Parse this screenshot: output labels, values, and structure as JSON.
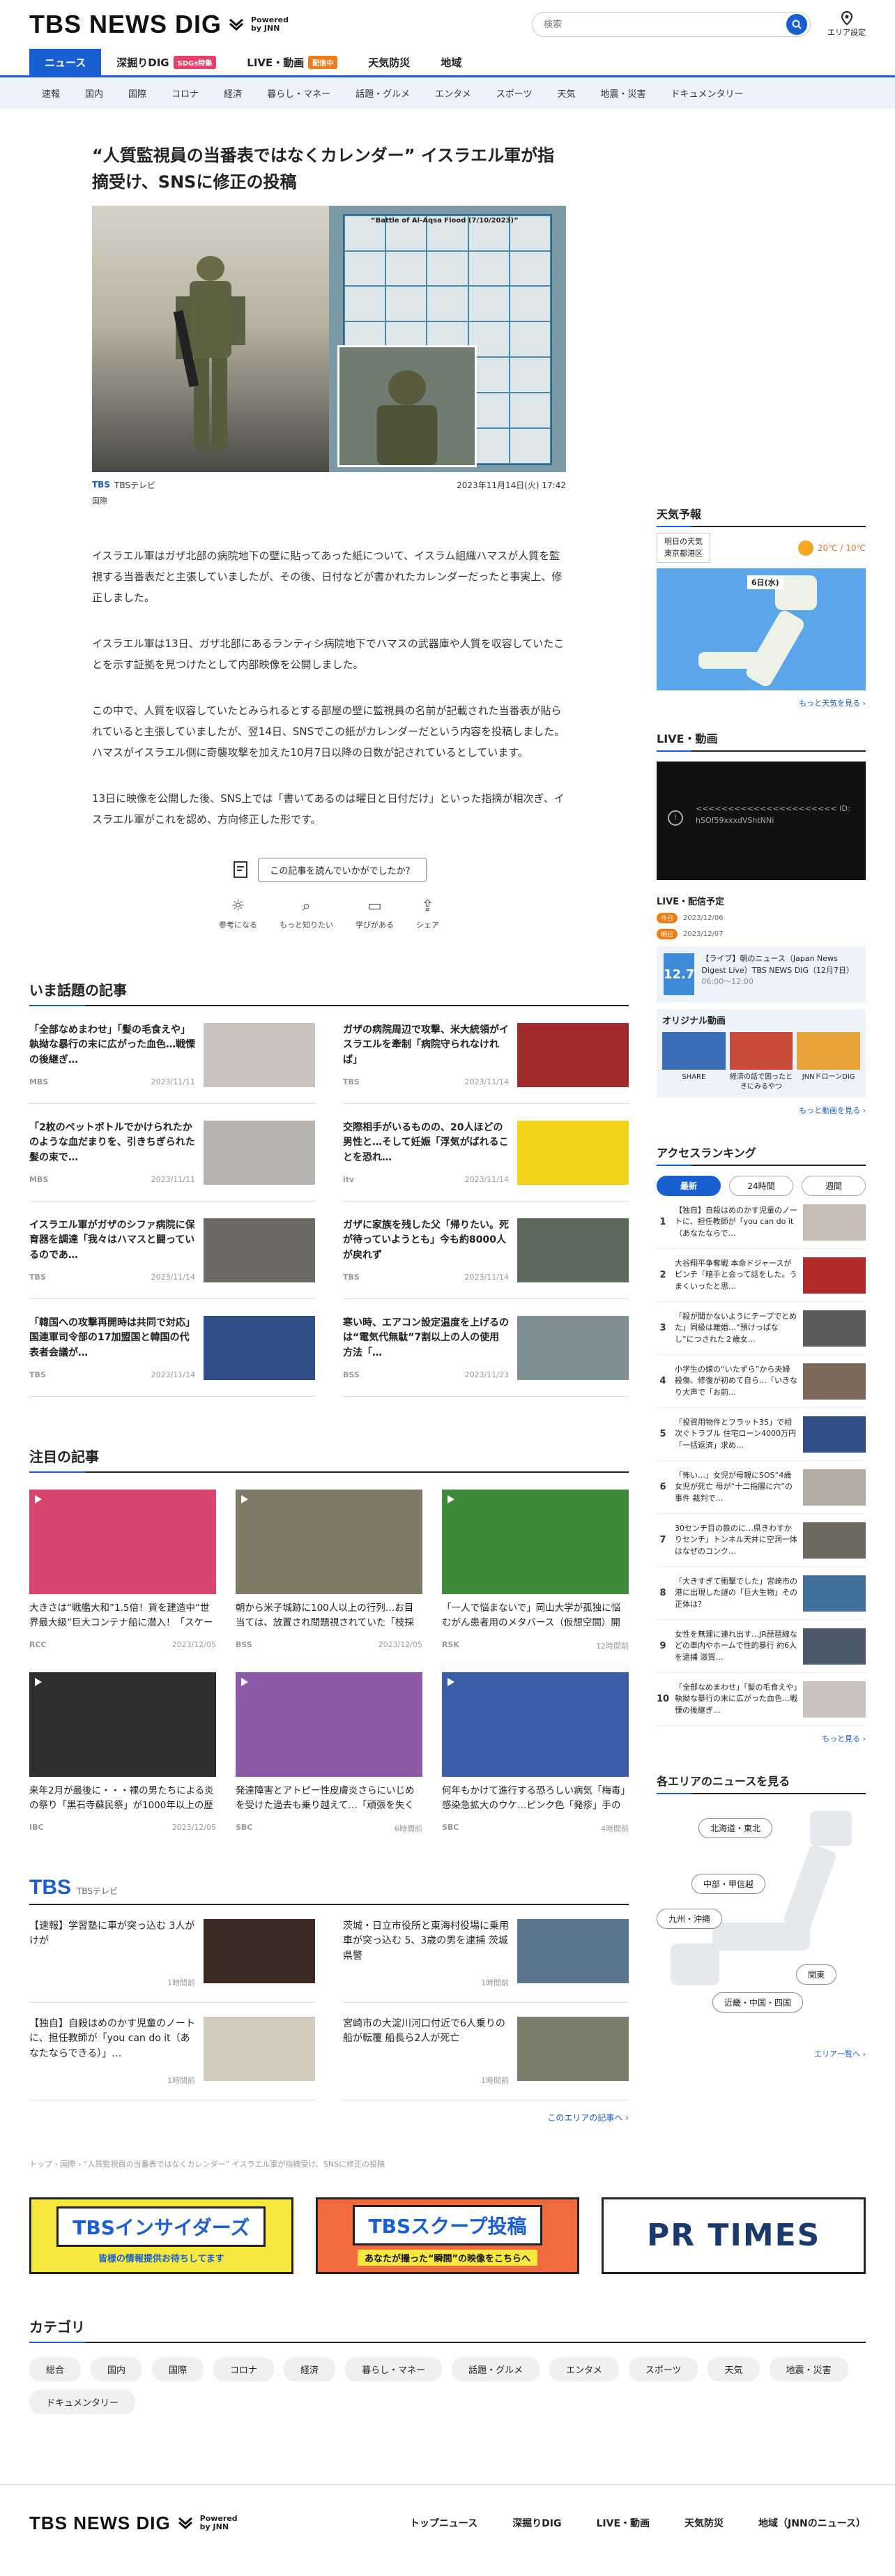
{
  "site": {
    "logo": "TBS NEWS DIG",
    "powered_line1": "Powered",
    "powered_line2": "by JNN",
    "search_placeholder": "検索",
    "area_setting": "エリア設定"
  },
  "gnav": [
    {
      "label": "ニュース",
      "active": true,
      "badge": ""
    },
    {
      "label": "深掘りDIG",
      "active": false,
      "badge": "SDGs特集"
    },
    {
      "label": "LIVE・動画",
      "active": false,
      "badge": "配信中"
    },
    {
      "label": "天気防災",
      "active": false,
      "badge": ""
    },
    {
      "label": "地域",
      "active": false,
      "badge": ""
    }
  ],
  "subnav": [
    "速報",
    "国内",
    "国際",
    "コロナ",
    "経済",
    "暮らし・マネー",
    "話題・グルメ",
    "エンタメ",
    "スポーツ",
    "天気",
    "地震・災害",
    "ドキュメンタリー"
  ],
  "article": {
    "title": "“人質監視員の当番表ではなくカレンダー” イスラエル軍が指摘受け、SNSに修正の投稿",
    "image_caption": "“Battle of Al-Aqsa Flood (7/10/2023)”",
    "source_logo": "TBS",
    "source": "TBSテレビ",
    "datetime": "2023年11月14日(火) 17:42",
    "genre": "国際",
    "paragraphs": [
      "イスラエル軍はガザ北部の病院地下の壁に貼ってあった紙について、イスラム組織ハマスが人質を監視する当番表だと主張していましたが、その後、日付などが書かれたカレンダーだったと事実上、修正しました。",
      "イスラエル軍は13日、ガザ北部にあるランティシ病院地下でハマスの武器庫や人質を収容していたことを示す証拠を見つけたとして内部映像を公開しました。",
      "この中で、人質を収容していたとみられるとする部屋の壁に監視員の名前が記載された当番表が貼られていると主張していましたが、翌14日、SNSでこの紙がカレンダーだという内容を投稿しました。ハマスがイスラエル側に奇襲攻撃を加えた10月7日以降の日数が記されているとしています。",
      "13日に映像を公開した後、SNS上では「書いてあるのは曜日と日付だけ」といった指摘が相次ぎ、イスラエル軍がこれを認め、方向修正した形です。"
    ],
    "feedback_question": "この記事を読んでいかがでしたか？",
    "feedback": [
      "参考になる",
      "もっと知りたい",
      "学びがある",
      "シェア"
    ]
  },
  "hot": {
    "title": "いま話題の記事",
    "items": [
      {
        "title": "「全部なめまわせ」「髪の毛食えや」執拗な暴行の末に広がった血色…戦慄の後継ぎ…",
        "src": "MBS",
        "date": "2023/11/11",
        "color": "#c9c2bd"
      },
      {
        "title": "ガザの病院周辺で攻撃、米大統領がイスラエルを牽制「病院守られなければ」",
        "src": "TBS",
        "date": "2023/11/14",
        "color": "#a22b2b"
      },
      {
        "title": "「2枚のペットボトルでかけられたかのような血だまりを、引きちぎられた髪の束で…",
        "src": "MBS",
        "date": "2023/11/11",
        "color": "#b8b3ae"
      },
      {
        "title": "交際相手がいるものの、20人ほどの男性と…そして妊娠「浮気がばれることを恐れ…",
        "src": "itv",
        "date": "2023/11/14",
        "color": "#f2d41a"
      },
      {
        "title": "イスラエル軍がガザのシファ病院に保育器を調達「我々はハマスと闘っているのであ…",
        "src": "TBS",
        "date": "2023/11/14",
        "color": "#6d6a64"
      },
      {
        "title": "ガザに家族を残した父「帰りたい。死が待っていようとも」今も約8000人が戻れず",
        "src": "TBS",
        "date": "2023/11/14",
        "color": "#5b6a5a"
      },
      {
        "title": "「韓国への攻撃再開時は共同で対応」国連軍司令部の17加盟国と韓国の代表者会議が…",
        "src": "TBS",
        "date": "2023/11/14",
        "color": "#2f4e8a"
      },
      {
        "title": "寒い時、エアコン設定温度を上げるのは“電気代無駄”7割以上の人の使用方法「…",
        "src": "BSS",
        "date": "2023/11/23",
        "color": "#7d8e96"
      }
    ]
  },
  "featured": {
    "title": "注目の記事",
    "items": [
      {
        "title": "大きさは“戦艦大和”1.5倍！貨を建造中“世界最大級”巨大コンテナ船に潜入！「スケールでかすぎ」新…",
        "src": "RCC",
        "date": "2023/12/05",
        "color": "#d8456c"
      },
      {
        "title": "朝から米子城跡に100人以上の行列…お目当ては、放置され問題視されていた「枝採木」 木を何に使…",
        "src": "BSS",
        "date": "2023/12/05",
        "color": "#7e7a66"
      },
      {
        "title": "「一人で悩まないで」岡山大学が孤独に悩むがん患者用のメタバース（仮想空間）開発 外見気にせず…",
        "src": "RSK",
        "date": "12時間前",
        "color": "#3f8a3a"
      },
      {
        "title": "来年2月が最後に・・・裸の男たちによる炎の祭り「黒石寺蘇民祭」が1000年以上の歴史に幕 担い手…",
        "src": "IBC",
        "date": "2023/12/05",
        "color": "#2e2e2e"
      },
      {
        "title": "発達障害とアトピー性皮膚炎さらにいじめを受けた過去も乗り越えて…「頑張を失くしたいんです」母と…",
        "src": "SBC",
        "date": "6時間前",
        "color": "#8d5aa8"
      },
      {
        "title": "何年もかけて進行する恐ろしい病気「梅毒」感染急拡大のウケ…ピンク色「発疹」手のひらの「カサカサ…",
        "src": "SBC",
        "date": "4時間前",
        "color": "#3a5ea8"
      }
    ]
  },
  "tbs": {
    "logo": "TBS",
    "label": "TBSテレビ",
    "items": [
      {
        "title": "【速報】学習塾に車が突っ込む 3人がけが",
        "date": "1時間前",
        "color": "#3a2a22"
      },
      {
        "title": "茨城・日立市役所と東海村役場に乗用車が突っ込む 5、3歳の男を逮捕 茨城県警",
        "date": "1時間前",
        "color": "#5d7690"
      },
      {
        "title": "【独自】自殺はめのかす児童のノートに、担任教師が「you can do it（あなたならできる）」…",
        "date": "1時間前",
        "color": "#d3c9bd"
      },
      {
        "title": "宮崎市の大淀川河口付近で6人乗りの船が転覆 船長ら2人が死亡",
        "date": "1時間前",
        "color": "#7a7f6c"
      }
    ],
    "more": "このエリアの記事へ ›"
  },
  "weather": {
    "title": "天気予報",
    "area_line1": "明日の天気",
    "area_line2": "東京都港区",
    "temp": "20℃ / 10℃",
    "map_label": "6日(水)",
    "more": "もっと天気を見る ›"
  },
  "live": {
    "title": "LIVE・動画",
    "video_text": "<<<<<<<<<<<<<<<<<<<<<< ID: hSOf59xxxdVShtNNi",
    "schedule_title": "LIVE・配信予定",
    "sched": [
      {
        "tag": "今日",
        "date": "2023/12/06"
      },
      {
        "tag": "明日",
        "date": "2023/12/07"
      }
    ],
    "live_thumb": "12.7",
    "live_text": "【ライブ】朝のニュース（Japan News Digest Live）TBS NEWS DIG（12月7日）",
    "live_time": "06:00～12:00",
    "original_title": "オリジナル動画",
    "originals": [
      "SHARE",
      "経済の話で困ったときにみるやつ",
      "JNNドローンDIG"
    ],
    "more": "もっと動画を見る ›"
  },
  "ranking": {
    "title": "アクセスランキング",
    "tabs": [
      "最新",
      "24時間",
      "週間"
    ],
    "items": [
      {
        "no": "1",
        "title": "【独自】自殺はめのかす児童のノートに、担任教師が「you can do it（あなたならで…",
        "color": "#c8bdb4"
      },
      {
        "no": "2",
        "title": "大谷翔平争奪戦 本命ドジャースがピンチ「暗手と会って話をした。うまくいったと思…",
        "color": "#b22a2a"
      },
      {
        "no": "3",
        "title": "「殺が聞かないようにテープでとめた」同級は離婚…“預けっぱなし”につされた２歳女…",
        "color": "#5a5a5a"
      },
      {
        "no": "4",
        "title": "小学生の娘の“いたずら”から夫婦殺傷、修復が初めて自ら…「いきなり大声で「お前…",
        "color": "#7b6a5a"
      },
      {
        "no": "5",
        "title": "「投資用物件とフラット35」で相次ぐトラブル 住宅ローン4000万円「一括返済」求め…",
        "color": "#2f4e8a"
      },
      {
        "no": "6",
        "title": "「怖い…」女児が母親にSOS“4歳女児が死亡 母が“十二指腸に穴”の事件 裁判で…",
        "color": "#b5aca4"
      },
      {
        "no": "7",
        "title": "30センチ目の鉄のに…県きわすかりセンチ」トンネル天井に空洞一体はなぜのコンク…",
        "color": "#6e6a5d"
      },
      {
        "no": "8",
        "title": "「大きすぎて衝撃でした」宮崎市の港に出現した謎の「巨大生物」その正体は？",
        "color": "#41719b"
      },
      {
        "no": "9",
        "title": "女性を無理に連れ出す…JR琵琶線などの車内やホームで性的暴行 約6人を逮捕 滋賀…",
        "color": "#4c5a6a"
      },
      {
        "no": "10",
        "title": "「全部なめまわせ」「髪の毛食えや」執拗な暴行の末に広がった血色…戦慄の後継ぎ…",
        "color": "#c9c2bd"
      }
    ],
    "more": "もっと見る ›"
  },
  "areas": {
    "title": "各エリアのニュースを見る",
    "buttons": [
      "北海道・東北",
      "中部・甲信越",
      "九州・沖縄",
      "関東",
      "近畿・中国・四国"
    ],
    "more": "エリア一覧へ ›"
  },
  "breadcrumb": "トップ › 国際 › “人質監視員の当番表ではなくカレンダー” イスラエル軍が指摘受け、SNSに修正の投稿",
  "banners": {
    "insiders": "TBSインサイダーズ",
    "insiders_sub": "皆様の情報提供お待ちしてます",
    "scoop": "TBSスクープ投稿",
    "scoop_sub": "あなたが撮った“瞬間”の映像をこちらへ",
    "prtimes": "PR TIMES"
  },
  "categories": {
    "title": "カテゴリ",
    "items": [
      "総合",
      "国内",
      "国際",
      "コロナ",
      "経済",
      "暮らし・マネー",
      "話題・グルメ",
      "エンタメ",
      "スポーツ",
      "天気",
      "地震・災害",
      "ドキュメンタリー"
    ]
  },
  "footer": {
    "nav": [
      "トップニュース",
      "深掘りDIG",
      "LIVE・動画",
      "天気防災",
      "地域（JNNのニュース）"
    ]
  }
}
